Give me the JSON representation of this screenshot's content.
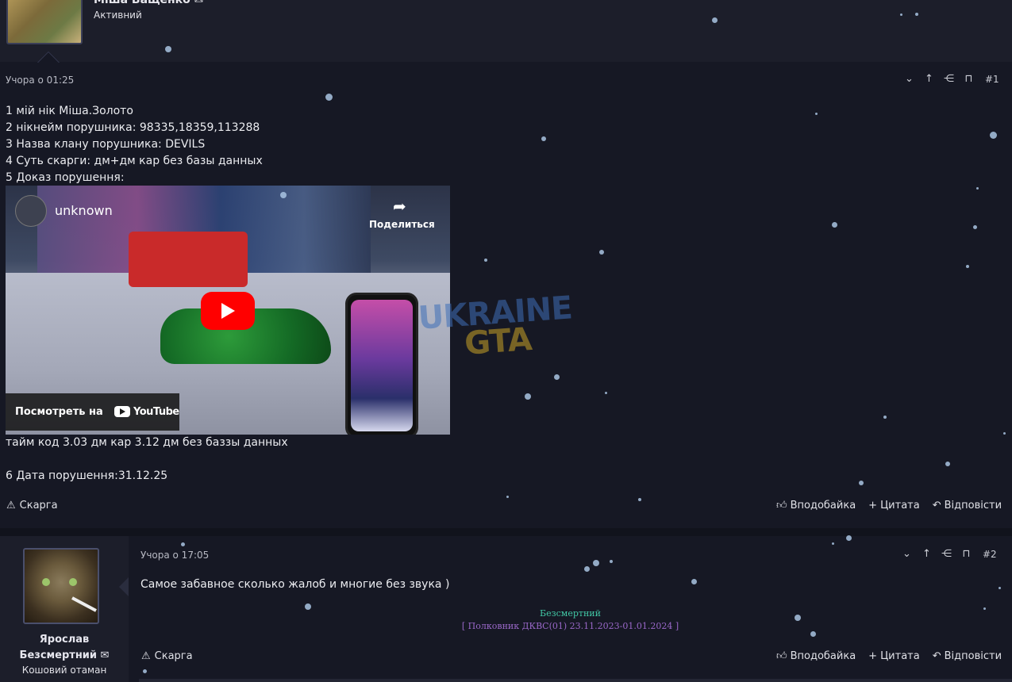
{
  "top_author": {
    "name": "Міша Ващенко ✉",
    "status": "Активний"
  },
  "post1": {
    "date": "Учора о 01:25",
    "number": "#1",
    "lines": [
      "1 мій нік Міша.Золото",
      "2 нікнейм порушника: 98335,18359,113288",
      "3 Назва клану порушника: DEVILS",
      "4 Суть скарги: дм+дм кар без базы данных",
      "5 Доказ порушення:"
    ],
    "video": {
      "channel": "unknown",
      "share_label": "Поделиться",
      "watch_label": "Посмотреть на",
      "youtube_label": "YouTube"
    },
    "after_video": "тайм код 3.03 дм кар 3.12 дм без баззы данных",
    "date_line": "6 Дата порушення:31.12.25",
    "report_label": "Скарга",
    "actions": {
      "like": "Вподобайка",
      "quote": "Цитата",
      "reply": "Відповісти"
    }
  },
  "watermark": {
    "line1": "UKRAINE",
    "line2": "GTA"
  },
  "post2": {
    "author_name_line1": "Ярослав",
    "author_name_line2": "Безсмертний ✉",
    "author_title": "Кошовий отаман",
    "date": "Учора о 17:05",
    "number": "#2",
    "text": "Самое забавное сколько жалоб и многие без звука )",
    "signature_name": "Безсмертний",
    "signature_rank": "[ Полковник ДКВС(01) 23.11.2023-01.01.2024 ]",
    "report_label": "Скарга",
    "actions": {
      "like": "Вподобайка",
      "quote": "Цитата",
      "reply": "Відповісти"
    }
  },
  "icons": {
    "tools": [
      "chevron-down-circle-icon",
      "arrow-up-icon",
      "share-icon",
      "bookmark-icon"
    ],
    "report": "warning-icon",
    "like": "thumbs-up-icon",
    "quote": "plus-icon",
    "reply": "reply-arrow-icon"
  },
  "colors": {
    "background": "#161824",
    "panel": "#1c1e2a",
    "signature_name": "#42c9a6",
    "signature_rank": "#9a68c9",
    "snow": "#a9c4e2"
  }
}
